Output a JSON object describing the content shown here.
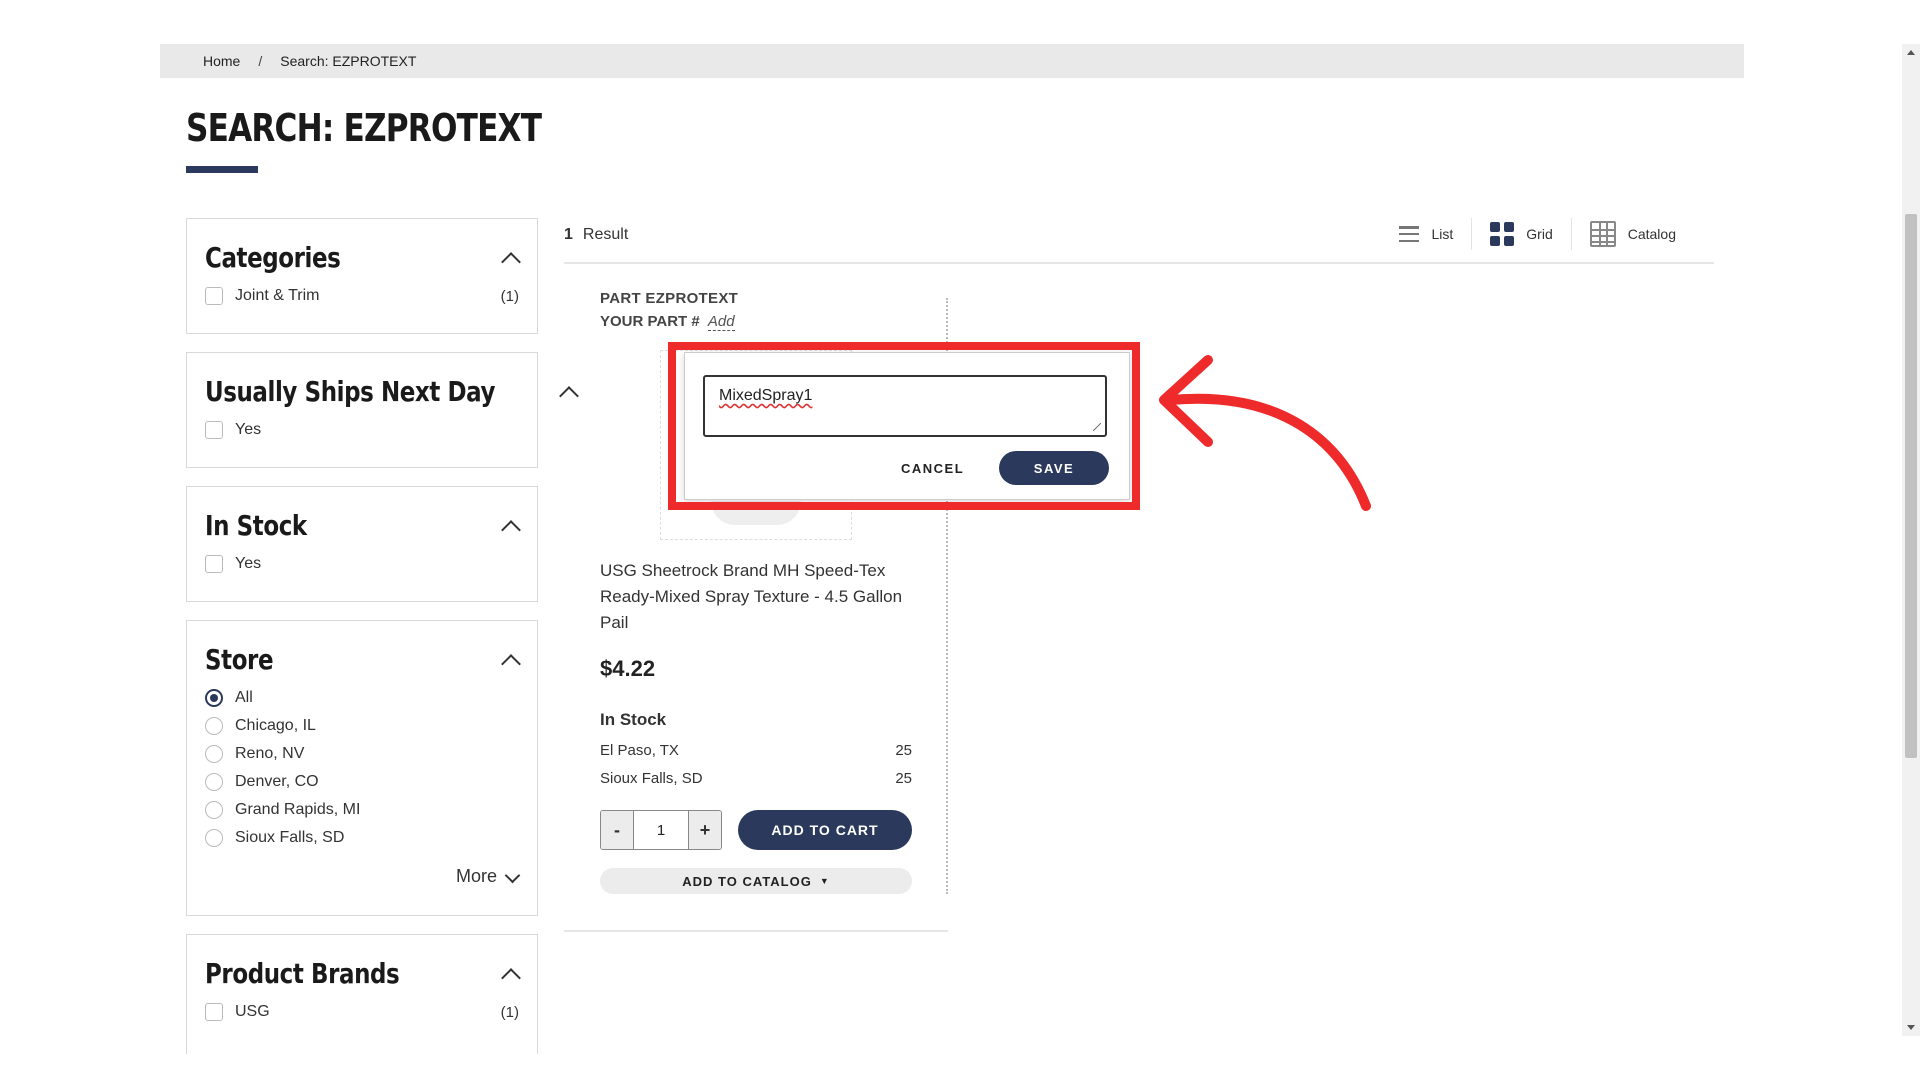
{
  "breadcrumb": {
    "home": "Home",
    "separator": "/",
    "current": "Search: EZPROTEXT"
  },
  "page_title": "SEARCH: EZPROTEXT",
  "filters": {
    "categories": {
      "title": "Categories",
      "items": [
        {
          "label": "Joint & Trim",
          "count": "(1)"
        }
      ]
    },
    "ships": {
      "title": "Usually Ships Next Day",
      "items": [
        {
          "label": "Yes"
        }
      ]
    },
    "instock": {
      "title": "In Stock",
      "items": [
        {
          "label": "Yes"
        }
      ]
    },
    "store": {
      "title": "Store",
      "selected": "All",
      "items": [
        {
          "label": "All"
        },
        {
          "label": "Chicago, IL"
        },
        {
          "label": "Reno, NV"
        },
        {
          "label": "Denver, CO"
        },
        {
          "label": "Grand Rapids, MI"
        },
        {
          "label": "Sioux Falls, SD"
        }
      ],
      "more_label": "More"
    },
    "brands": {
      "title": "Product Brands",
      "items": [
        {
          "label": "USG",
          "count": "(1)"
        }
      ]
    }
  },
  "results": {
    "count": "1",
    "count_label": "Result"
  },
  "view_options": {
    "list": "List",
    "grid": "Grid",
    "catalog": "Catalog",
    "active": "Grid"
  },
  "product": {
    "part_line": "PART EZPROTEXT",
    "your_part_label": "YOUR PART #",
    "your_part_add": "Add",
    "name": "USG Sheetrock Brand MH Speed-Tex Ready-Mixed Spray Texture - 4.5 Gallon Pail",
    "price": "$4.22",
    "stock_title": "In Stock",
    "stock": [
      {
        "location": "El Paso, TX",
        "qty": "25"
      },
      {
        "location": "Sioux Falls, SD",
        "qty": "25"
      }
    ],
    "quantity": "1",
    "minus": "-",
    "plus": "+",
    "add_to_cart": "ADD TO CART",
    "add_to_catalog": "ADD TO CATALOG"
  },
  "part_popover": {
    "value": "MixedSpray1",
    "cancel": "CANCEL",
    "save": "SAVE"
  },
  "colors": {
    "accent": "#2b3a5c",
    "annotation": "#ee2a2a"
  }
}
